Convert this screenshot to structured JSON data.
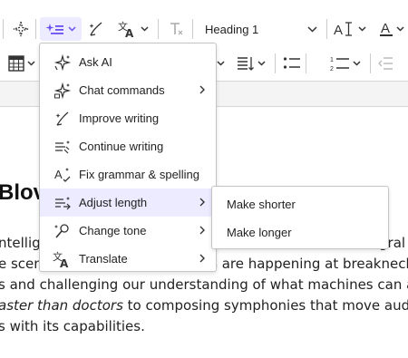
{
  "toolbar": {
    "heading_value": "Heading 1"
  },
  "menu": {
    "items": [
      {
        "label": "Ask AI",
        "icon": "sparkle-ask-icon"
      },
      {
        "label": "Chat commands",
        "icon": "sparkle-chat-icon"
      },
      {
        "label": "Improve writing",
        "icon": "pen-sparkle-icon"
      },
      {
        "label": "Continue writing",
        "icon": "continue-lines-icon"
      },
      {
        "label": "Fix grammar & spelling",
        "icon": "grammar-check-icon"
      },
      {
        "label": "Adjust length",
        "icon": "adjust-length-icon"
      },
      {
        "label": "Change tone",
        "icon": "tone-icon"
      },
      {
        "label": "Translate",
        "icon": "translate-icon"
      }
    ]
  },
  "submenu": {
    "items": [
      {
        "label": "Make shorter"
      },
      {
        "label": "Make longer"
      }
    ]
  },
  "document": {
    "heading_fragment": "Blov",
    "lines": [
      {
        "a": "ntellig",
        "b": "gral"
      },
      {
        "a": "e scen",
        "bold": "s",
        "rest": " are happening at breakneck s"
      },
      {
        "a": "s and challenging our understanding of what machines can accomp"
      },
      {
        "italic": "aster than doctors",
        "rest": " to composing symphonies that move audiences t"
      },
      {
        "a": "s with its capabilities."
      }
    ]
  },
  "colors": {
    "accent": "#6b4ef0",
    "highlight": "#ecebff",
    "border": "#c4c4c4"
  }
}
